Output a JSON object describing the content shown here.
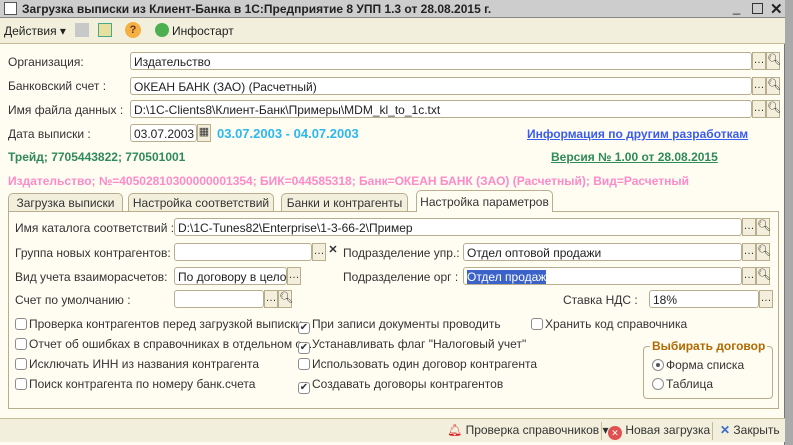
{
  "window": {
    "title": "Загрузка выписки из Клиент-Банка в 1С:Предприятие 8 УПП 1.3 от 28.08.2015 г."
  },
  "toolbar": {
    "actions": "Действия",
    "infostart": "Инфостарт"
  },
  "form": {
    "org_label": "Организация:",
    "org_value": "Издательство",
    "bank_label": "Банковский счет :",
    "bank_value": "ОКЕАН БАНК (ЗАО) (Расчетный)",
    "file_label": "Имя файла данных :",
    "file_value": "D:\\1C-Clients8\\Клиент-Банк\\Примеры\\MDM_kl_to_1c.txt",
    "date_label": "Дата выписки :",
    "date_value": "03.07.2003",
    "period": "03.07.2003 - 04.07.2003",
    "info_link": "Информация по другим разработкам",
    "trade": "Трейд; 7705443822; 770501001",
    "version": "Версия № 1.00 от 28.08.2015",
    "account_info": "Издательство; №=40502810300000001354; БИК=044585318; Банк=ОКЕАН БАНК (ЗАО) (Расчетный); Вид=Расчетный"
  },
  "tabs": [
    "Загрузка выписки",
    "Настройка соответствий",
    "Банки и контрагенты",
    "Настройка параметров"
  ],
  "params": {
    "catalog_label": "Имя каталога соответствий :",
    "catalog_value": "D:\\1C-Tunes82\\Enterprise\\1-3-66-2\\Пример",
    "group_label": "Группа новых контрагентов:",
    "group_value": "",
    "dept_mgmt_label": "Подразделение упр.:",
    "dept_mgmt_value": "Отдел оптовой продажи",
    "settle_label": "Вид учета взаиморасчетов:",
    "settle_value": "По договору в целом",
    "dept_org_label": "Подразделение орг :",
    "dept_org_value": "Отдел продаж",
    "account_label": "Счет по умолчанию :",
    "account_value": "",
    "vat_label": "Ставка НДС :",
    "vat_value": "18%"
  },
  "checkboxes": [
    {
      "label": "Проверка контрагентов перед загрузкой выписки",
      "checked": false
    },
    {
      "label": "Отчет об ошибках в справочниках в отдельном о...",
      "checked": false
    },
    {
      "label": "Исключать ИНН из названия контрагента",
      "checked": false
    },
    {
      "label": "Поиск контрагента по номеру банк.счета",
      "checked": false
    },
    {
      "label": "При записи документы проводить",
      "checked": true
    },
    {
      "label": "Устанавливать флаг \"Налоговый учет\"",
      "checked": true
    },
    {
      "label": "Использовать один договор контрагента",
      "checked": false
    },
    {
      "label": "Создавать договоры контрагентов",
      "checked": true
    },
    {
      "label": "Хранить код справочника",
      "checked": false
    }
  ],
  "contract_group": {
    "title": "Выбирать договор",
    "options": [
      "Форма списка",
      "Таблица"
    ],
    "selected": "Форма списка"
  },
  "bottom": {
    "check": "Проверка справочников",
    "new_load": "Новая загрузка",
    "close": "Закрыть"
  },
  "colors": {
    "period": "#2bb8ee",
    "link": "#3b5cf0",
    "green": "#2e8b57",
    "pink": "#ff8ac8",
    "group": "#b06a00"
  }
}
